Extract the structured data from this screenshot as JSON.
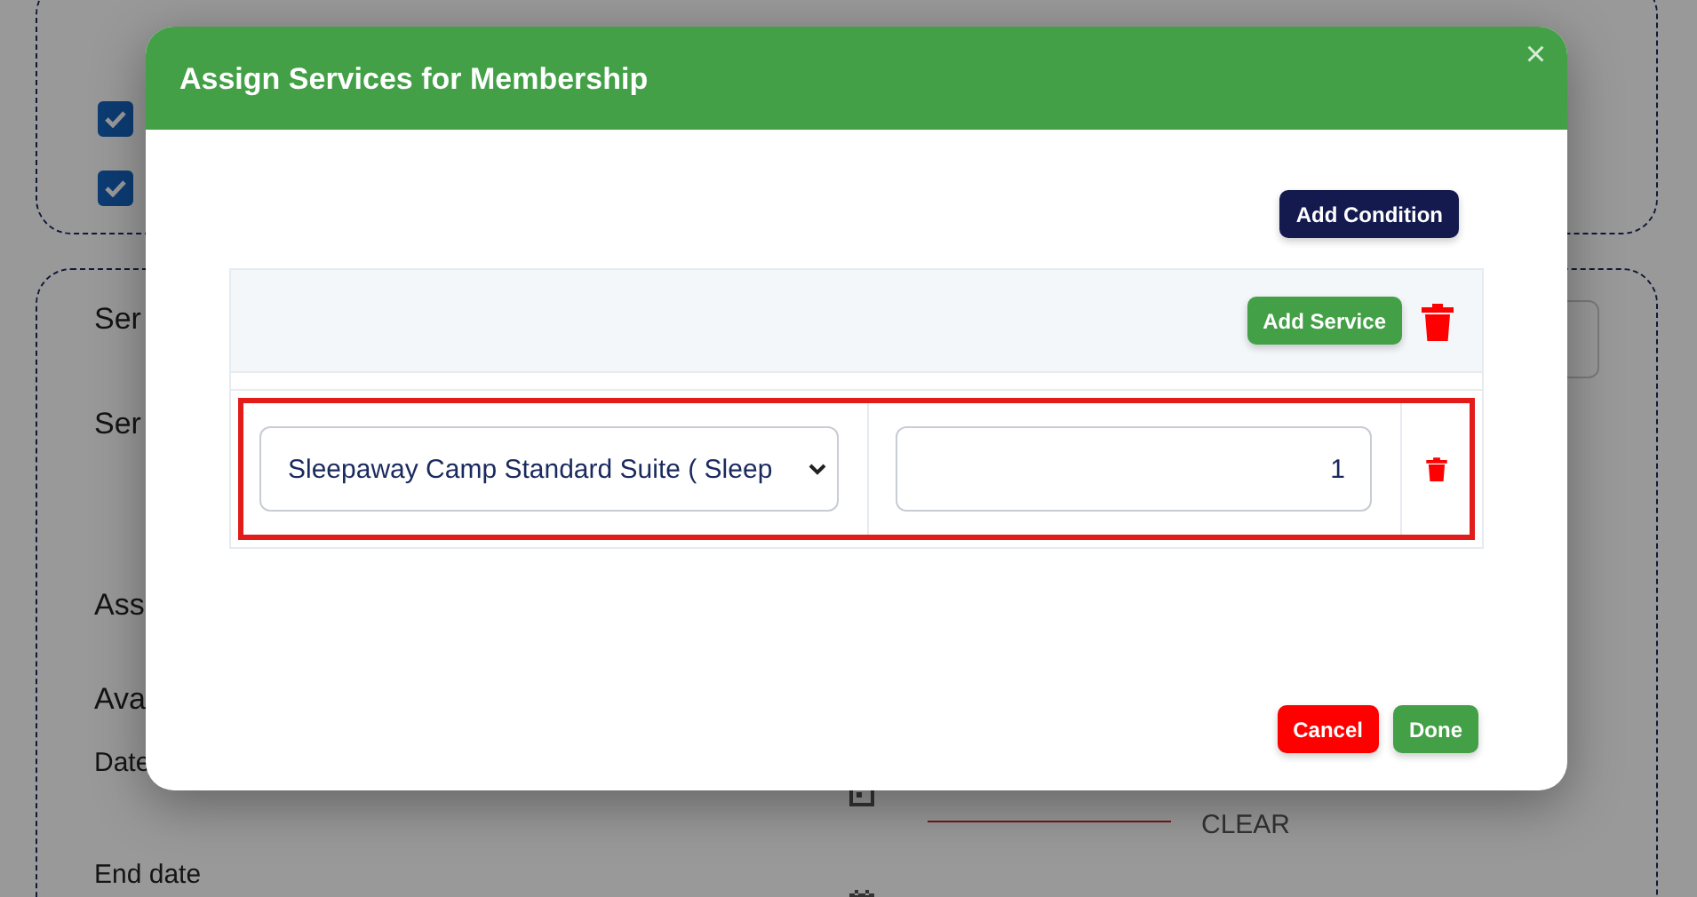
{
  "background": {
    "checkboxes": [
      {
        "checked": true
      },
      {
        "checked": true
      }
    ],
    "labels": [
      "Ser",
      "Ser",
      "Ass",
      "Ava"
    ],
    "date_fields": [
      {
        "label": "Date",
        "clear": "CLEAR"
      },
      {
        "label": "End date"
      }
    ]
  },
  "modal": {
    "title": "Assign Services for Membership",
    "close": "×",
    "add_condition": "Add Condition",
    "add_service": "Add Service",
    "rows": [
      {
        "service": "Sleepaway Camp Standard Suite ( Sleep",
        "quantity": "1",
        "highlighted": true
      }
    ],
    "buttons": [
      {
        "label": "Cancel",
        "kind": "cancel"
      },
      {
        "label": "Done",
        "kind": "done"
      }
    ]
  }
}
